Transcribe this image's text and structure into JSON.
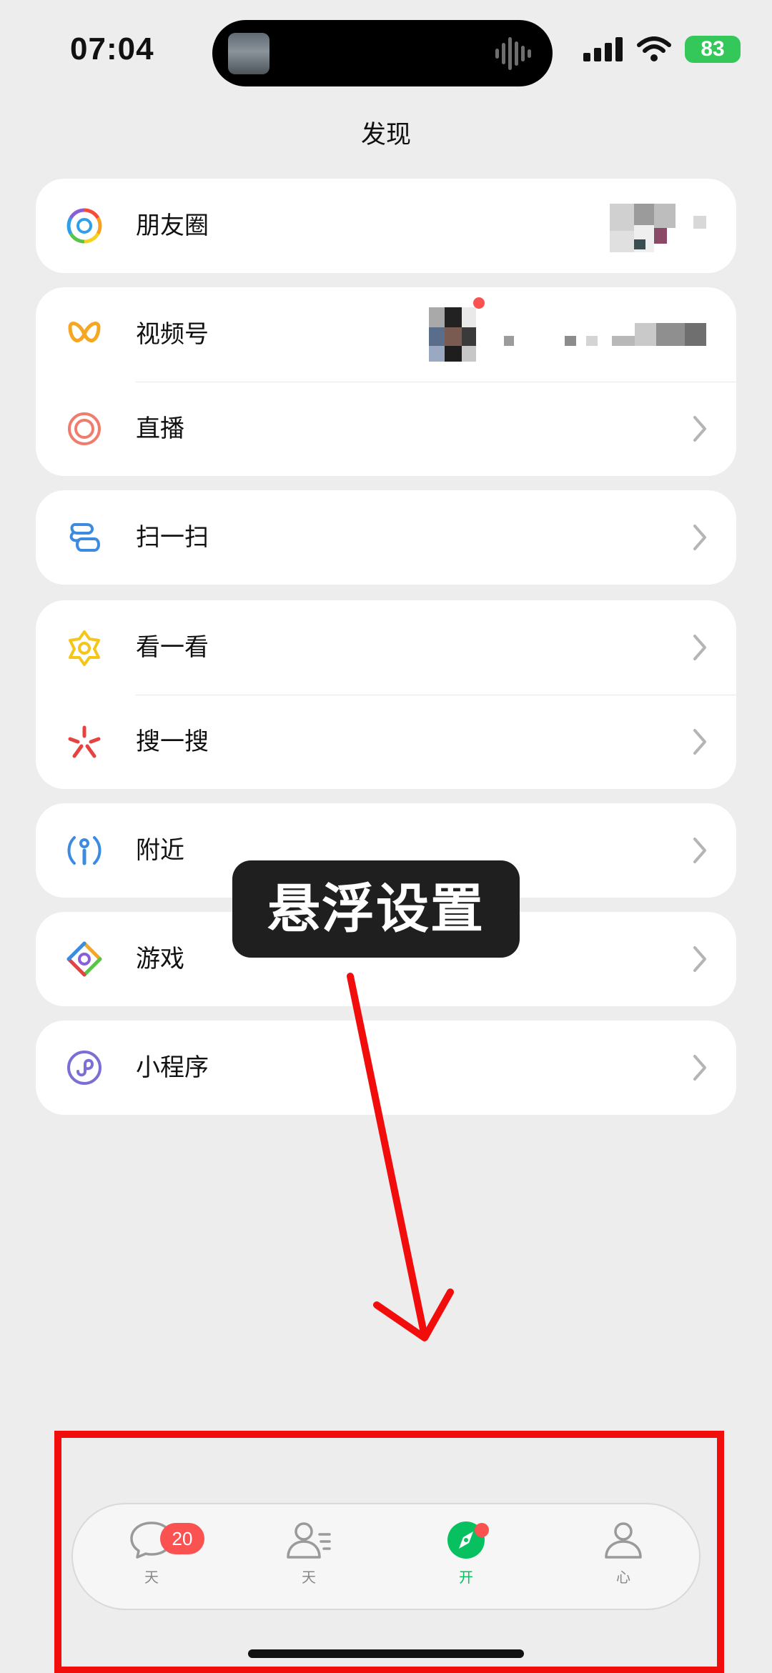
{
  "status_bar": {
    "time": "07:04",
    "battery": "83"
  },
  "page": {
    "title": "发现"
  },
  "sections": [
    {
      "rows": [
        {
          "label": "朋友圈",
          "icon": "moments-icon"
        }
      ]
    },
    {
      "rows": [
        {
          "label": "视频号",
          "icon": "channels-icon"
        },
        {
          "label": "直播",
          "icon": "live-icon"
        }
      ]
    },
    {
      "rows": [
        {
          "label": "扫一扫",
          "icon": "scan-icon"
        }
      ]
    },
    {
      "rows": [
        {
          "label": "看一看",
          "icon": "top-stories-icon"
        },
        {
          "label": "搜一搜",
          "icon": "search-icon"
        }
      ]
    },
    {
      "rows": [
        {
          "label": "附近",
          "icon": "nearby-icon"
        }
      ]
    },
    {
      "rows": [
        {
          "label": "游戏",
          "icon": "games-icon"
        }
      ]
    },
    {
      "rows": [
        {
          "label": "小程序",
          "icon": "mini-programs-icon"
        }
      ]
    }
  ],
  "overlay": {
    "label": "悬浮设置"
  },
  "tab_bar": {
    "tabs": [
      {
        "label": "天",
        "icon": "chat-bubble-icon",
        "badge": "20"
      },
      {
        "label": "天",
        "icon": "contacts-icon"
      },
      {
        "label": "开",
        "icon": "compass-icon",
        "active": true,
        "dot": true
      },
      {
        "label": "心",
        "icon": "person-icon"
      }
    ]
  },
  "colors": {
    "accent": "#07c160",
    "badge": "#fa5151",
    "annotation": "#f20d0d",
    "background": "#ededed"
  }
}
